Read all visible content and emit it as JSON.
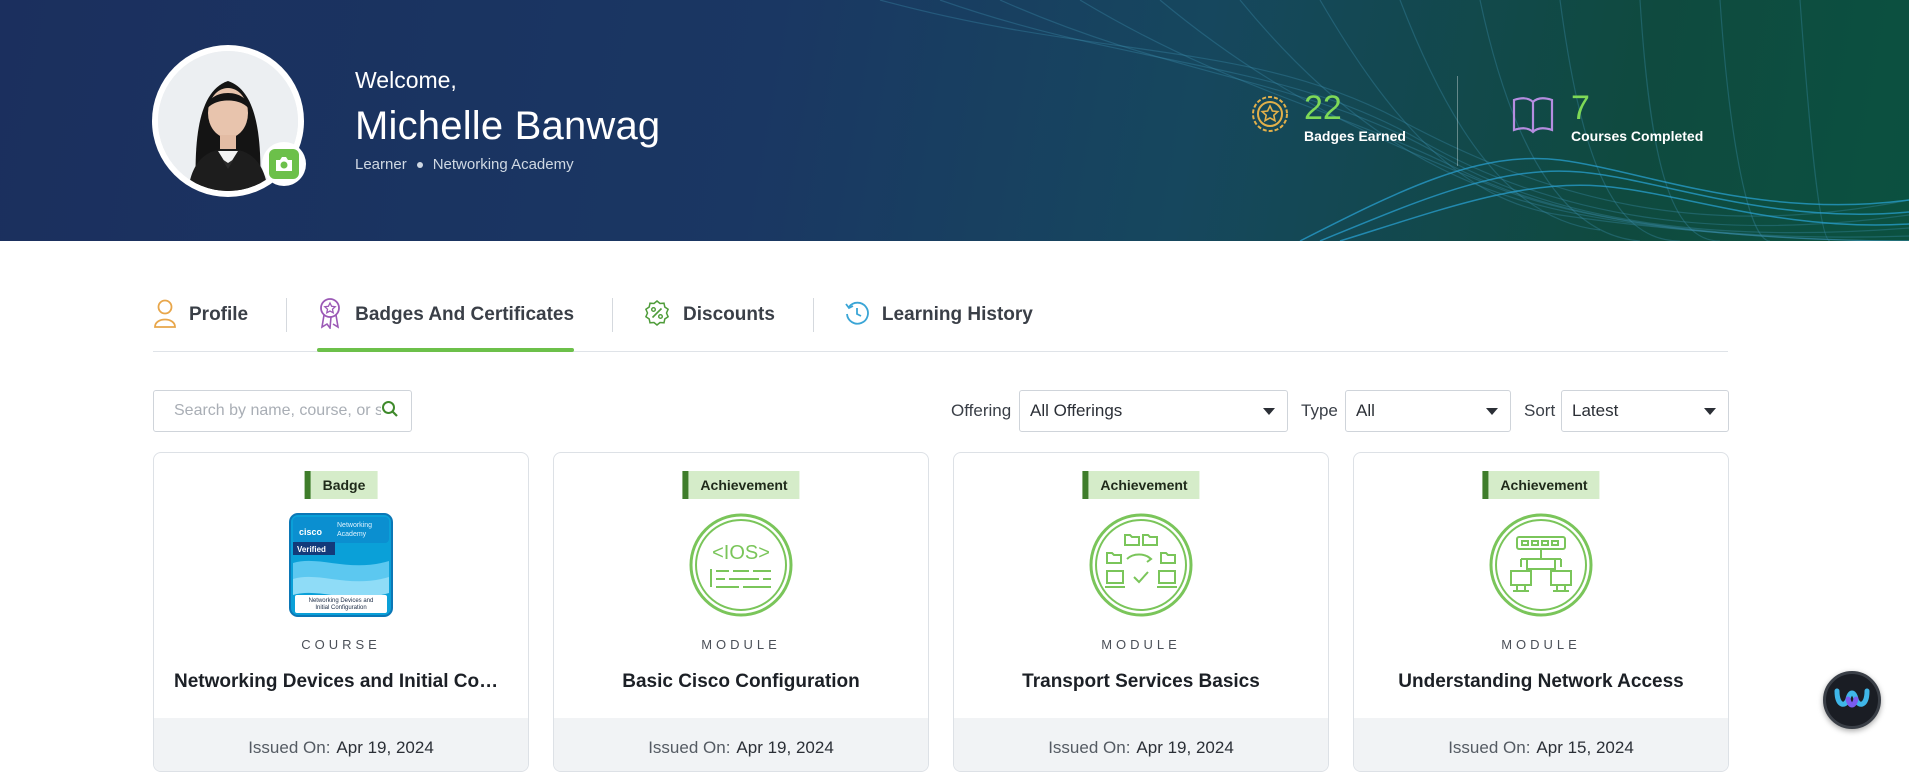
{
  "header": {
    "welcome": "Welcome,",
    "name": "Michelle Banwag",
    "role": "Learner",
    "org": "Networking Academy",
    "stats": [
      {
        "value": "22",
        "label": "Badges Earned",
        "icon": "award-icon"
      },
      {
        "value": "7",
        "label": "Courses Completed",
        "icon": "book-icon"
      }
    ]
  },
  "tabs": [
    {
      "label": "Profile",
      "icon": "person-icon"
    },
    {
      "label": "Badges And Certificates",
      "icon": "ribbon-icon",
      "active": true
    },
    {
      "label": "Discounts",
      "icon": "discount-icon"
    },
    {
      "label": "Learning History",
      "icon": "history-icon"
    }
  ],
  "filters": {
    "search_placeholder": "Search by name, course, or skill",
    "offering_label": "Offering",
    "offering_value": "All Offerings",
    "type_label": "Type",
    "type_value": "All",
    "sort_label": "Sort",
    "sort_value": "Latest"
  },
  "cards": [
    {
      "tag": "Badge",
      "type": "COURSE",
      "title": "Networking Devices and Initial Configuration",
      "issued_label": "Issued On:",
      "issued_date": "Apr 19, 2024",
      "badge_image_text": {
        "brand": "cisco",
        "program": "Networking Academy",
        "status": "Verified",
        "caption": "Networking Devices and Initial Configuration"
      }
    },
    {
      "tag": "Achievement",
      "type": "MODULE",
      "title": "Basic Cisco Configuration",
      "issued_label": "Issued On:",
      "issued_date": "Apr 19, 2024",
      "icon": "ios-icon",
      "icon_text": "<IOS>"
    },
    {
      "tag": "Achievement",
      "type": "MODULE",
      "title": "Transport Services Basics",
      "issued_label": "Issued On:",
      "issued_date": "Apr 19, 2024",
      "icon": "transport-icon"
    },
    {
      "tag": "Achievement",
      "type": "MODULE",
      "title": "Understanding Network Access",
      "issued_label": "Issued On:",
      "issued_date": "Apr 15, 2024",
      "icon": "network-access-icon"
    }
  ],
  "colors": {
    "accent": "#6cc04a",
    "stat_number": "#7ed957",
    "tag_bg": "#d5ecc9",
    "tag_border": "#3f7d2b"
  },
  "assistant_icon": "webex-assistant-icon"
}
